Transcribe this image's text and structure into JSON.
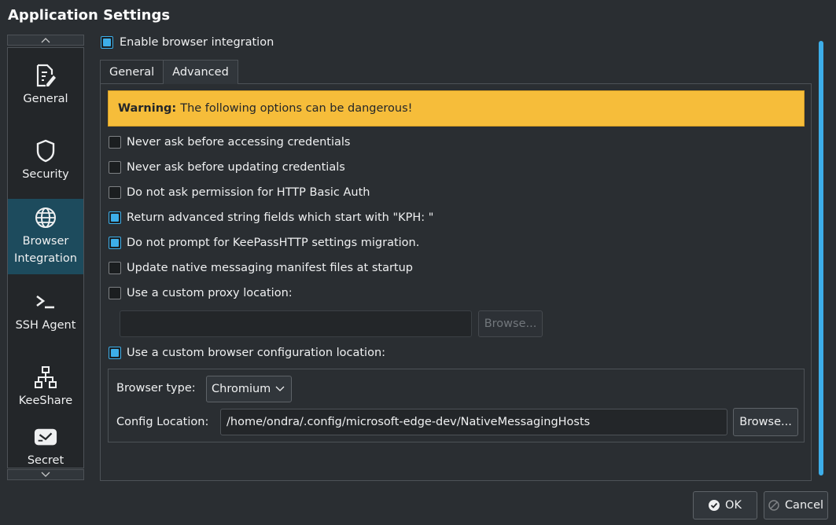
{
  "window": {
    "title": "Application Settings"
  },
  "sidebar": {
    "scroll_up": "▲",
    "scroll_down": "▼",
    "items": [
      {
        "label": "General",
        "icon": "document-edit-icon"
      },
      {
        "label": "Security",
        "icon": "shield-icon"
      },
      {
        "label": "Browser Integration",
        "icon": "globe-icon",
        "active": true
      },
      {
        "label": "SSH Agent",
        "icon": "terminal-icon"
      },
      {
        "label": "KeeShare",
        "icon": "network-icon"
      },
      {
        "label": "Secret",
        "icon": "secret-service-icon"
      }
    ]
  },
  "browser": {
    "enable_label": "Enable browser integration",
    "enable_checked": true,
    "tabs": [
      {
        "label": "General",
        "active": false
      },
      {
        "label": "Advanced",
        "active": true
      }
    ],
    "warning": {
      "bold": "Warning:",
      "text": "The following options can be dangerous!"
    },
    "options": [
      {
        "label": "Never ask before accessing credentials",
        "checked": false
      },
      {
        "label": "Never ask before updating credentials",
        "checked": false
      },
      {
        "label": "Do not ask permission for HTTP Basic Auth",
        "checked": false
      },
      {
        "label": "Return advanced string fields which start with \"KPH: \"",
        "checked": true
      },
      {
        "label": "Do not prompt for KeePassHTTP settings migration.",
        "checked": true
      },
      {
        "label": "Update native messaging manifest files at startup",
        "checked": false
      },
      {
        "label": "Use a custom proxy location:",
        "checked": false
      }
    ],
    "proxy": {
      "value": "",
      "browse_label": "Browse..."
    },
    "custom_config": {
      "label": "Use a custom browser configuration location:",
      "checked": true
    },
    "browser_type": {
      "label": "Browser type:",
      "value": "Chromium"
    },
    "config_location": {
      "label": "Config Location:",
      "value": "/home/ondra/.config/microsoft-edge-dev/NativeMessagingHosts",
      "browse_label": "Browse..."
    }
  },
  "footer": {
    "ok_label": "OK",
    "cancel_label": "Cancel"
  },
  "colors": {
    "accent": "#3daee9",
    "warning": "#f6bd3a",
    "active_item": "#1d4b5d"
  }
}
